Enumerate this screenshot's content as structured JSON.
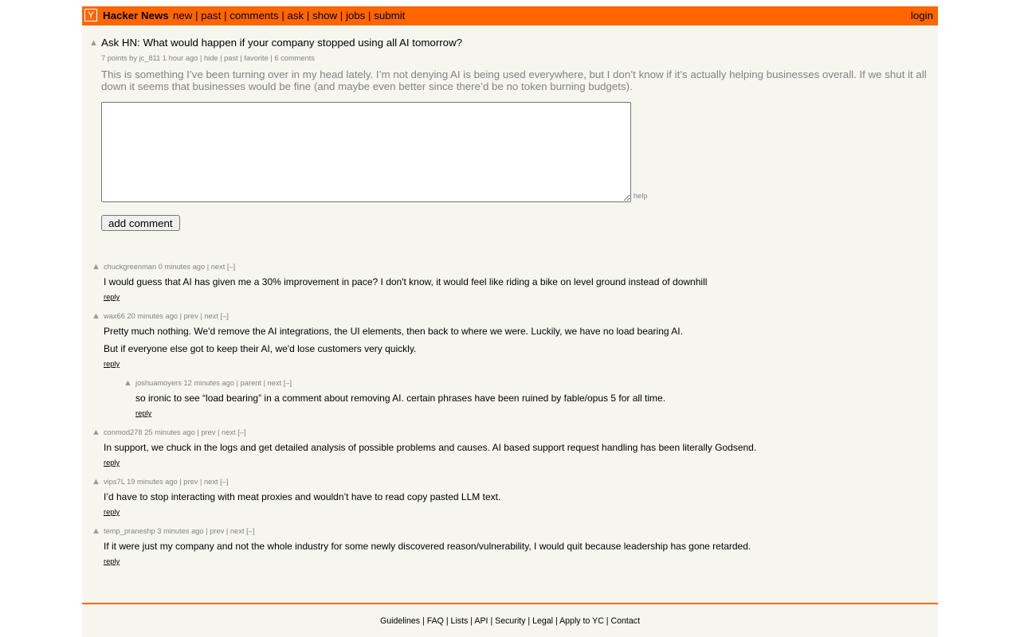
{
  "header": {
    "logo": "Y",
    "site_name": "Hacker News",
    "nav": [
      "new",
      "past",
      "comments",
      "ask",
      "show",
      "jobs",
      "submit"
    ],
    "login": "login",
    "accent_color": "#ff6600"
  },
  "story": {
    "title": "Ask HN: What would happen if your company stopped using all AI tomorrow?",
    "points": "7 points",
    "by": "by",
    "user": "jc_811",
    "age": "1 hour ago",
    "links": [
      "hide",
      "past",
      "favorite",
      "6 comments"
    ],
    "text": "This is something I’ve been turning over in my head lately. I’m not denying AI is being used everywhere, but I don’t know if it’s actually helping businesses overall. If we shut it all down it seems that businesses would be fine (and maybe even better since there’d be no token burning budgets)."
  },
  "form": {
    "textarea_value": "",
    "help": "help",
    "submit_label": "add comment"
  },
  "comments": [
    {
      "user": "chuckgreenman",
      "age": "0 minutes ago",
      "links": [
        "next",
        "[–]"
      ],
      "paragraphs": [
        "I would guess that AI has given me a 30% improvement in pace? I don't know, it would feel like riding a bike on level ground instead of downhill"
      ],
      "reply": "reply"
    },
    {
      "user": "wax66",
      "age": "20 minutes ago",
      "links": [
        "prev",
        "next",
        "[–]"
      ],
      "paragraphs": [
        "Pretty much nothing. We'd remove the AI integrations, the UI elements, then back to where we were. Luckily, we have no load bearing AI.",
        "But if everyone else got to keep their AI, we'd lose customers very quickly."
      ],
      "reply": "reply"
    },
    {
      "user": "joshuamoyers",
      "age": "12 minutes ago",
      "links": [
        "parent",
        "next",
        "[–]"
      ],
      "paragraphs": [
        "so ironic to see “load bearing” in a comment about removing AI. certain phrases have been ruined by fable/opus 5 for all time."
      ],
      "reply": "reply"
    },
    {
      "user": "conmod278",
      "age": "25 minutes ago",
      "links": [
        "prev",
        "next",
        "[–]"
      ],
      "paragraphs": [
        "In support, we chuck in the logs and get detailed analysis of possible problems and causes. AI based support request handling has been literally Godsend."
      ],
      "reply": "reply"
    },
    {
      "user": "vips7L",
      "age": "19 minutes ago",
      "links": [
        "prev",
        "next",
        "[–]"
      ],
      "paragraphs": [
        "I’d have to stop interacting with meat proxies and wouldn’t have to read copy pasted LLM text."
      ],
      "reply": "reply"
    },
    {
      "user": "temp_praneshp",
      "age": "3 minutes ago",
      "links": [
        "prev",
        "next",
        "[–]"
      ],
      "paragraphs": [
        "If it were just my company and not the whole industry for some newly discovered reason/vulnerability, I would quit because leadership has gone retarded."
      ],
      "reply": "reply"
    }
  ],
  "footer": {
    "links": [
      "Guidelines",
      "FAQ",
      "Lists",
      "API",
      "Security",
      "Legal",
      "Apply to YC",
      "Contact"
    ]
  }
}
